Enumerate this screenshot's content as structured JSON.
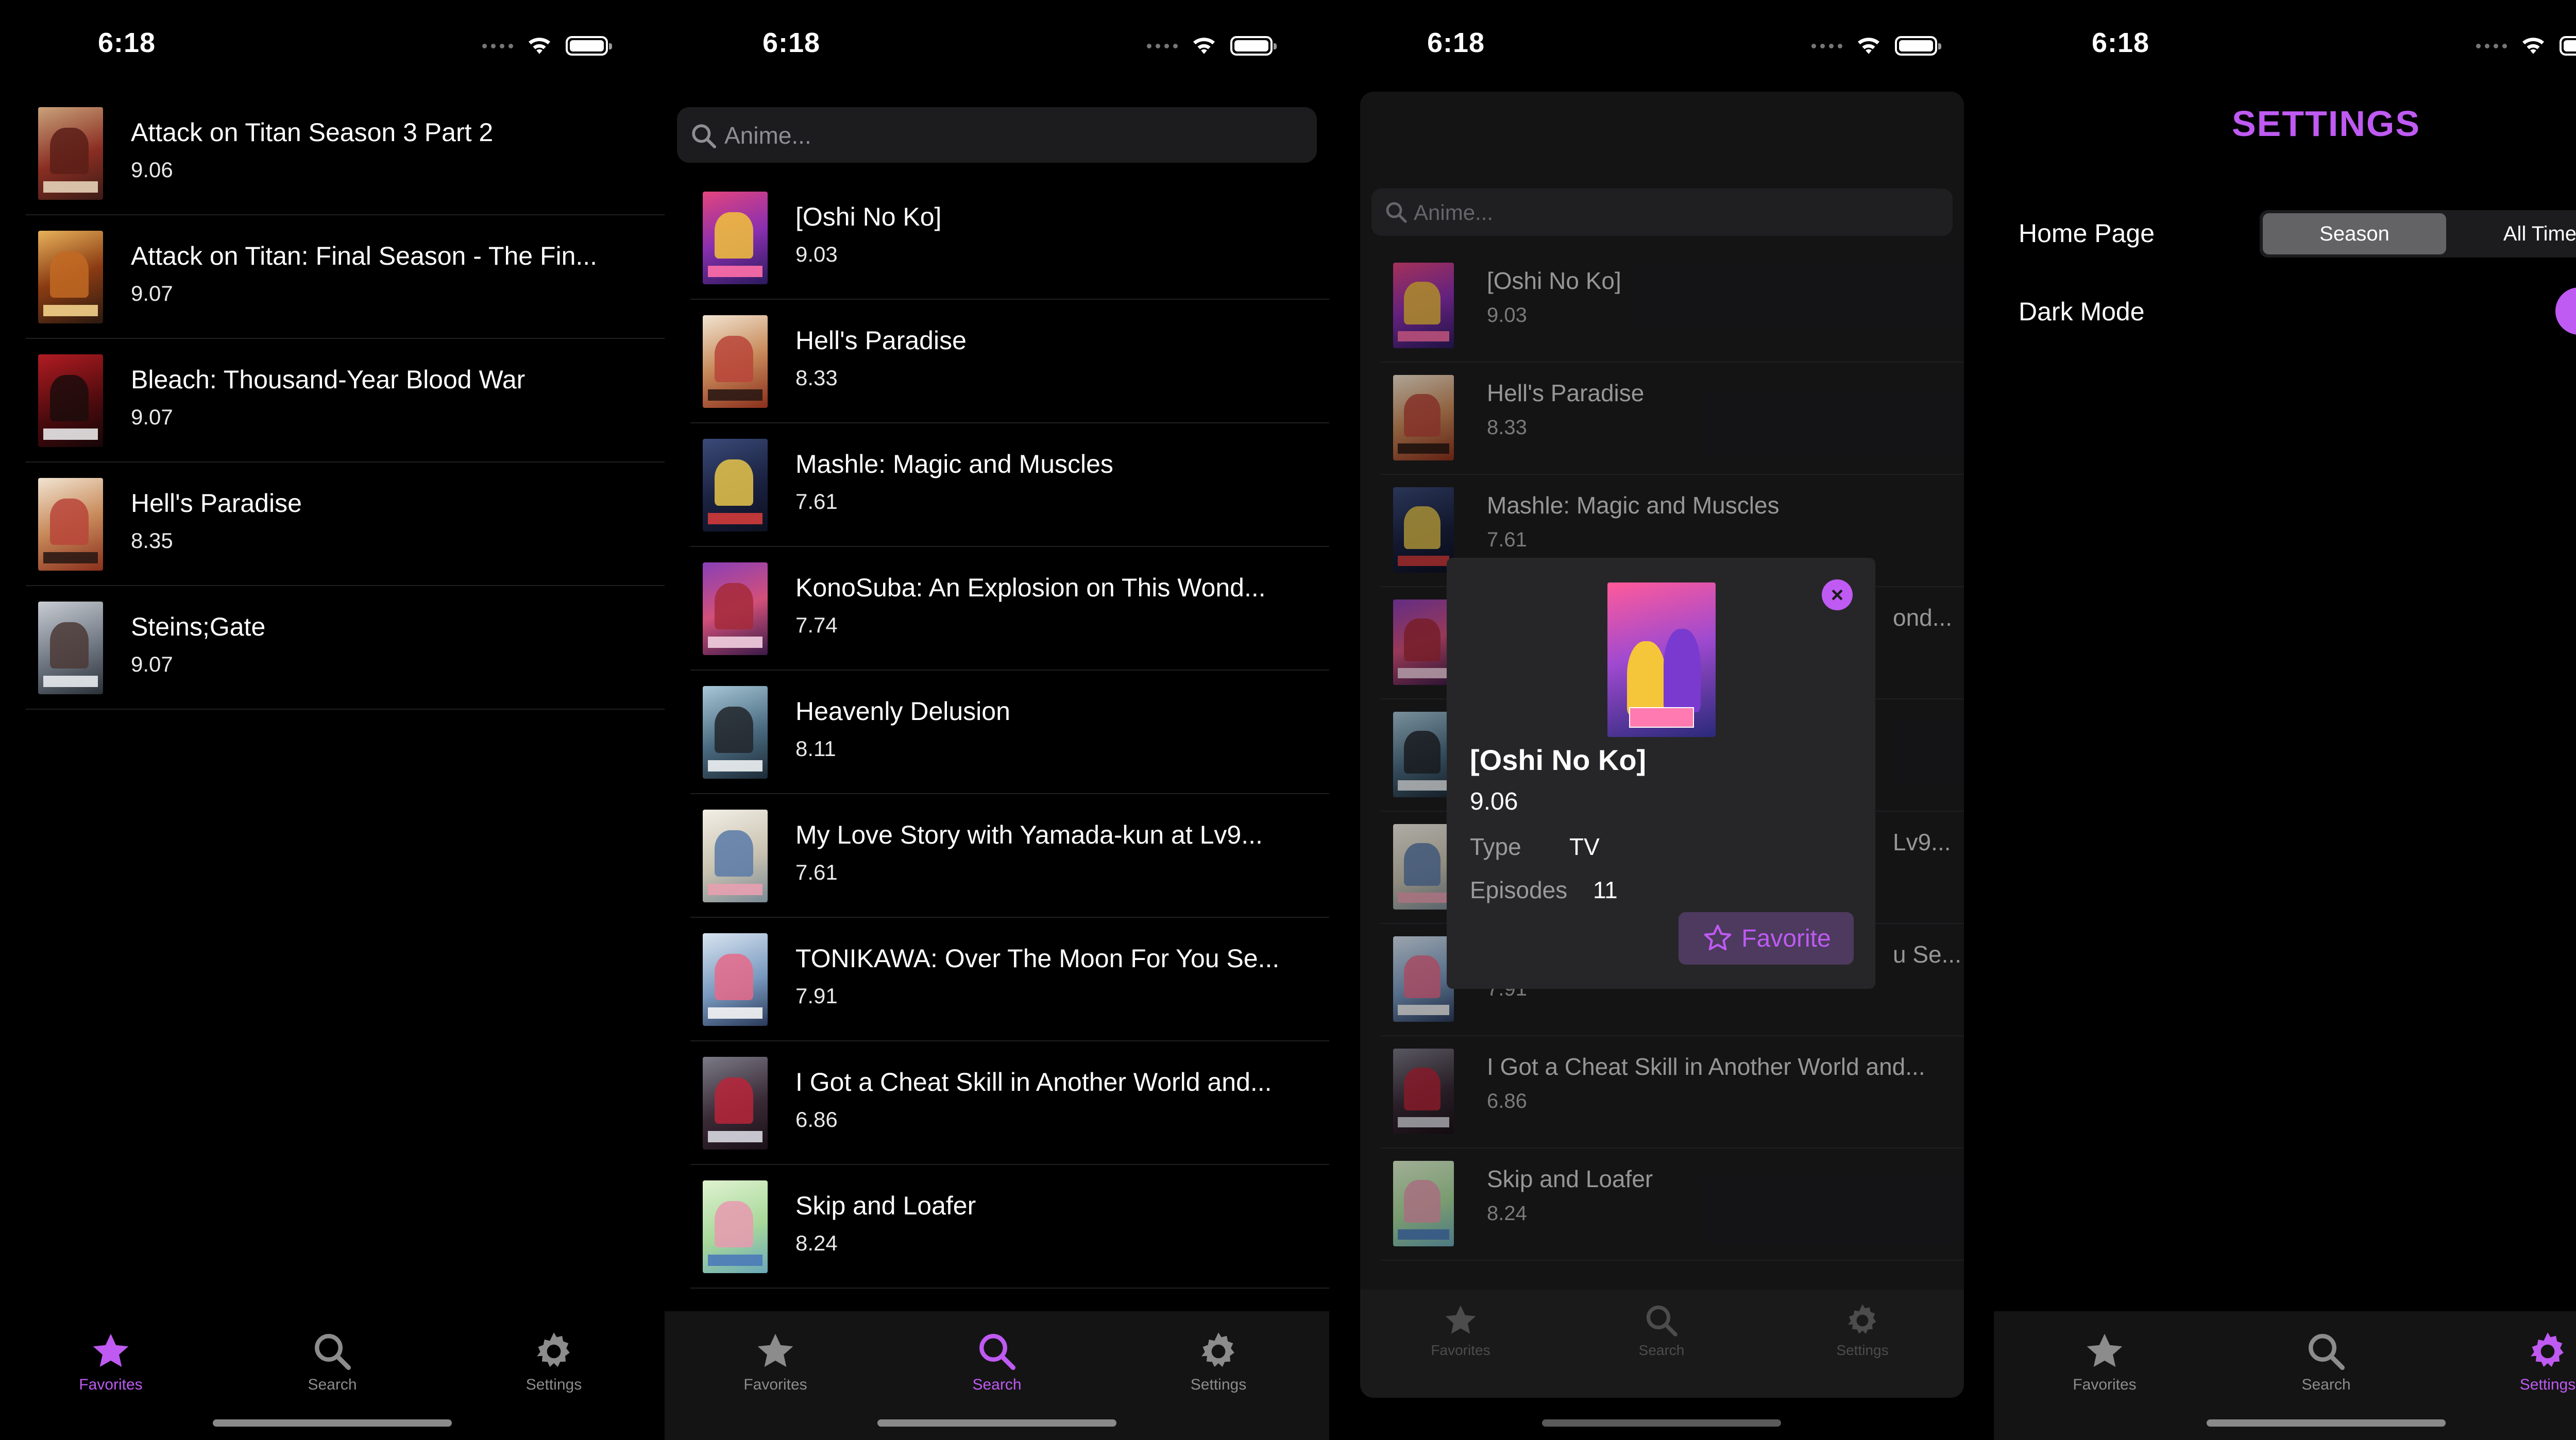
{
  "status": {
    "time": "6:18"
  },
  "colors": {
    "accent": "#bf5af2",
    "background": "#000000"
  },
  "tabs": [
    {
      "label": "Favorites",
      "icon": "star-icon"
    },
    {
      "label": "Search",
      "icon": "search-icon"
    },
    {
      "label": "Settings",
      "icon": "gear-icon"
    }
  ],
  "favorites": {
    "items": [
      {
        "title": "Attack on Titan Season 3 Part 2",
        "score": "9.06"
      },
      {
        "title": "Attack on Titan: Final Season - The Fin...",
        "score": "9.07"
      },
      {
        "title": "Bleach: Thousand-Year Blood War",
        "score": "9.07"
      },
      {
        "title": "Hell's Paradise",
        "score": "8.35"
      },
      {
        "title": "Steins;Gate",
        "score": "9.07"
      }
    ]
  },
  "search": {
    "placeholder": "Anime...",
    "results": [
      {
        "title": "[Oshi No Ko]",
        "score": "9.03"
      },
      {
        "title": "Hell's Paradise",
        "score": "8.33"
      },
      {
        "title": "Mashle: Magic and Muscles",
        "score": "7.61"
      },
      {
        "title": "KonoSuba: An Explosion on This Wond...",
        "score": "7.74"
      },
      {
        "title": "Heavenly Delusion",
        "score": "8.11"
      },
      {
        "title": "My Love Story with Yamada-kun at Lv9...",
        "score": "7.61"
      },
      {
        "title": "TONIKAWA: Over The Moon For You Se...",
        "score": "7.91"
      },
      {
        "title": "I Got a Cheat Skill in Another World and...",
        "score": "6.86"
      },
      {
        "title": "Skip and Loafer",
        "score": "8.24"
      }
    ]
  },
  "sheet": {
    "visible_titles": [
      {
        "title": "[Oshi No Ko]",
        "score": "9.03"
      },
      {
        "title": "Hell's Paradise",
        "score": "8.33"
      },
      {
        "title": "Mashle: Magic and Muscles",
        "score": "7.61"
      },
      {
        "title": "ond...",
        "score": ""
      },
      {
        "title": "",
        "score": ""
      },
      {
        "title": "Lv9...",
        "score": ""
      },
      {
        "title": "u Se...",
        "score": "7.91"
      },
      {
        "title": "I Got a Cheat Skill in Another World and...",
        "score": "6.86"
      },
      {
        "title": "Skip and Loafer",
        "score": "8.24"
      }
    ]
  },
  "detail": {
    "title": "[Oshi No Ko]",
    "score": "9.06",
    "type_label": "Type",
    "type_value": "TV",
    "episodes_label": "Episodes",
    "episodes_value": "11",
    "favorite_label": "Favorite",
    "close_glyph": "×"
  },
  "settings": {
    "title": "SETTINGS",
    "home_page_label": "Home Page",
    "home_page_options": [
      "Season",
      "All Time"
    ],
    "home_page_selected": "Season",
    "dark_mode_label": "Dark Mode",
    "dark_mode_on": true
  }
}
